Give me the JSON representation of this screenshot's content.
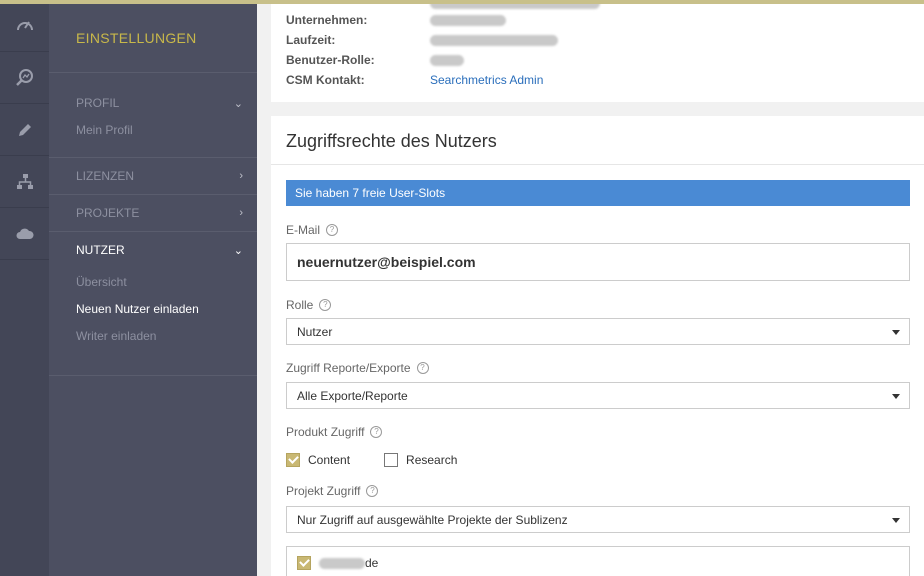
{
  "rail": {
    "items": [
      {
        "icon": "dashboard-gauge-icon"
      },
      {
        "icon": "search-analytics-icon"
      },
      {
        "icon": "pencil-icon"
      },
      {
        "icon": "sitemap-icon"
      },
      {
        "icon": "cloud-icon"
      }
    ]
  },
  "nav": {
    "title": "EINSTELLUNGEN",
    "profil": {
      "label": "PROFIL",
      "sub": "Mein Profil"
    },
    "lizenzen": {
      "label": "LIZENZEN"
    },
    "projekte": {
      "label": "PROJEKTE"
    },
    "nutzer": {
      "label": "NUTZER",
      "items": [
        "Übersicht",
        "Neuen Nutzer einladen",
        "Writer einladen"
      ]
    }
  },
  "account": {
    "unternehmen_label": "Unternehmen:",
    "laufzeit_label": "Laufzeit:",
    "rolle_label": "Benutzer-Rolle:",
    "csm_label": "CSM Kontakt:",
    "csm_value": "Searchmetrics Admin"
  },
  "rights": {
    "title": "Zugriffsrechte des Nutzers",
    "slots_text": "Sie haben 7 freie User-Slots",
    "email_label": "E-Mail",
    "email_value": "neuernutzer@beispiel.com",
    "rolle_label": "Rolle",
    "rolle_value": "Nutzer",
    "reporte_label": "Zugriff Reporte/Exporte",
    "reporte_value": "Alle Exporte/Reporte",
    "produkt_label": "Produkt Zugriff",
    "produkt_content": "Content",
    "produkt_content_checked": true,
    "produkt_research": "Research",
    "produkt_research_checked": false,
    "projekt_label": "Projekt Zugriff",
    "projekt_value": "Nur Zugriff auf ausgewählte Projekte der Sublizenz",
    "projekt_item_suffix": "de"
  },
  "colors": {
    "accent_gold": "#c8b84a",
    "link_blue": "#2a6ebb",
    "banner_blue": "#4a8ad4"
  }
}
